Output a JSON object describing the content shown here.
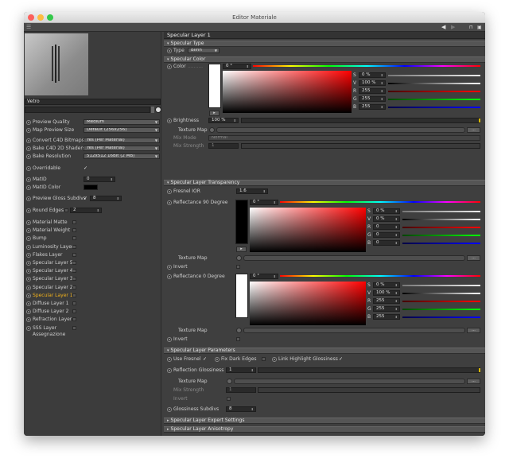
{
  "window": {
    "title": "Editor Materiale"
  },
  "toolbar": {
    "nav_back": "◀",
    "nav_fwd": "▶",
    "lock": "🔒",
    "menu": "☰"
  },
  "left": {
    "material_name": "Vetro",
    "preview_quality": {
      "label": "Preview Quality",
      "value": "Medium"
    },
    "map_preview_size": {
      "label": "Map Preview Size",
      "value": "Default (256x256)"
    },
    "convert_c4d": {
      "label": "Convert C4D Bitmaps",
      "value": "Yes (Per Material)"
    },
    "bake_c4d": {
      "label": "Bake C4D 2D Shaders",
      "value": "Yes (Per Material)"
    },
    "bake_res": {
      "label": "Bake Resolution",
      "value": "512x512   16Bit   (2 MB)"
    },
    "overridable": {
      "label": "Overridable",
      "check": "✓"
    },
    "mat_id": {
      "label": "MatID",
      "value": "0"
    },
    "mat_id_color": {
      "label": "MatID Color"
    },
    "preview_gloss": {
      "label": "Preview Gloss Subdivs",
      "check": "✓",
      "value": "8"
    },
    "round_edges": {
      "label": "Round Edges",
      "value": "2"
    },
    "layers": [
      {
        "label": "Material Matte"
      },
      {
        "label": "Material Weight"
      },
      {
        "label": "Bump"
      },
      {
        "label": "Luminosity Layer"
      },
      {
        "label": "Flakes Layer"
      },
      {
        "label": "Specular Layer 5"
      },
      {
        "label": "Specular Layer 4"
      },
      {
        "label": "Specular Layer 3"
      },
      {
        "label": "Specular Layer 2"
      },
      {
        "label": "Specular Layer 1"
      },
      {
        "label": "Diffuse Layer 1"
      },
      {
        "label": "Diffuse Layer 2"
      },
      {
        "label": "Refraction Layer"
      },
      {
        "label": "SSS Layer"
      }
    ],
    "assegnazione": "Assegnazione"
  },
  "right": {
    "header": "Specular Layer 1",
    "sec_type": "Specular Type",
    "type": {
      "label": "Type",
      "value": "Blinn"
    },
    "sec_color": "Specular Color",
    "color": {
      "label": "Color",
      "hue": "0 °",
      "s": "0 %",
      "v": "100 %",
      "r": "255",
      "g": "255",
      "b": "255"
    },
    "brightness": {
      "label": "Brightness",
      "value": "100 %"
    },
    "texture_map": "Texture Map",
    "mix_mode": {
      "label": "Mix Mode",
      "value": "Normal"
    },
    "mix_strength": {
      "label": "Mix Strength",
      "value": "1"
    },
    "sec_transparency": "Specular Layer Transparency",
    "fresnel_ior": {
      "label": "Fresnel IOR",
      "value": "1.6"
    },
    "refl90": {
      "label": "Reflectance 90 Degree",
      "hue": "0 °",
      "s": "0 %",
      "v": "0 %",
      "r": "0",
      "g": "0",
      "b": "0"
    },
    "texture_map2": "Texture Map",
    "invert": "Invert",
    "refl0": {
      "label": "Reflectance  0 Degree",
      "hue": "0 °",
      "s": "0 %",
      "v": "100 %",
      "r": "255",
      "g": "255",
      "b": "255"
    },
    "texture_map3": "Texture Map",
    "invert2": "Invert",
    "sec_params": "Specular Layer Parameters",
    "use_fresnel": {
      "label": "Use Fresnel",
      "check": "✓"
    },
    "fix_dark": {
      "label": "Fix Dark Edges"
    },
    "link_highlight": {
      "label": "Link Highlight Glossiness",
      "check": "✓"
    },
    "refl_gloss": {
      "label": "Reflection Glossiness",
      "value": "1"
    },
    "texture_map4": "Texture Map",
    "mix_strength2": {
      "label": "Mix Strength",
      "value": "1"
    },
    "invert3": "Invert",
    "gloss_subdivs": {
      "label": "Glossiness Subdivs",
      "value": "8"
    },
    "sec_expert": "Specular Layer Expert Settings",
    "sec_aniso": "Specular Layer Anisotropy",
    "btn_more": "..."
  },
  "colors": {
    "active": "#f2b21b",
    "window_bg": "#3f3f3f",
    "section": "#555555"
  }
}
